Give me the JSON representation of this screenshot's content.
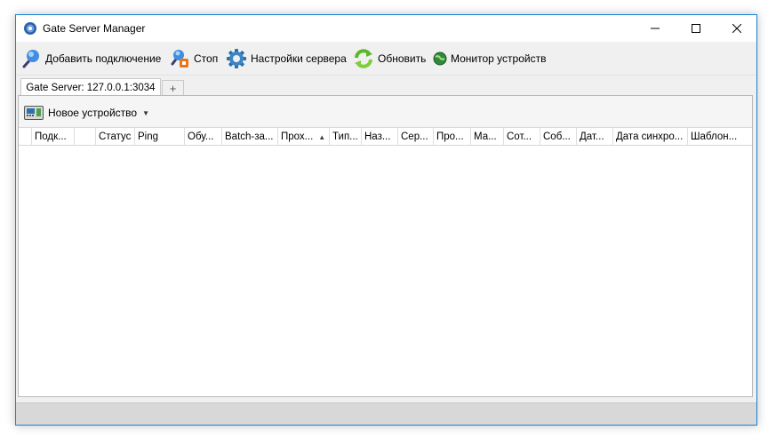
{
  "window": {
    "title": "Gate Server Manager"
  },
  "toolbar": {
    "add_connection": "Добавить подключение",
    "stop": "Стоп",
    "server_settings": "Настройки сервера",
    "refresh": "Обновить",
    "device_monitor": "Монитор устройств"
  },
  "tabs": {
    "active_label": "Gate Server: 127.0.0.1:3034",
    "add_label": "+"
  },
  "panel": {
    "new_device": "Новое устройство"
  },
  "grid": {
    "columns": [
      "",
      "Подк...",
      "",
      "Статус",
      "Ping",
      "Обу...",
      "Batch-за...",
      "Прох...",
      "Тип...",
      "Наз...",
      "Сер...",
      "Про...",
      "Ма...",
      "Сот...",
      "Соб...",
      "Дат...",
      "Дата синхро...",
      "Шаблон..."
    ],
    "rows": []
  },
  "colors": {
    "accent_border": "#1883d7",
    "highlight_underline": "#e03030"
  }
}
